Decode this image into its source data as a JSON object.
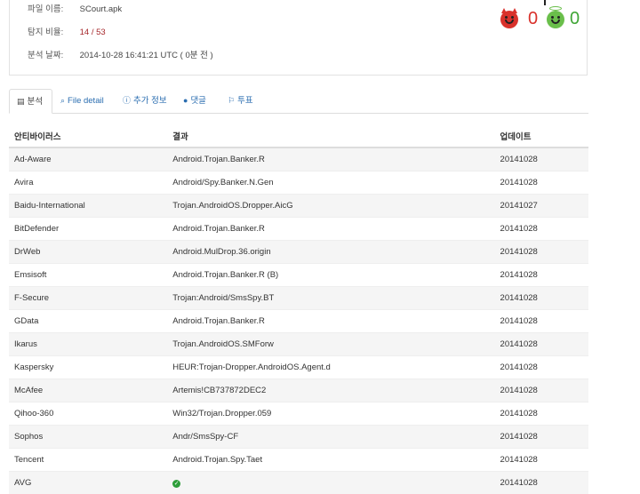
{
  "file_info": {
    "filename_label": "파일 이름:",
    "filename": "SCourt.apk",
    "detection_label": "탐지 비율:",
    "detection_ratio": "14 / 53",
    "date_label": "분석 날짜:",
    "date": "2014-10-28 16:41:21 UTC ( 0분 전 )"
  },
  "votes": {
    "malicious": "0",
    "harmless": "0"
  },
  "tabs": [
    {
      "label": "분석",
      "icon": "list-icon"
    },
    {
      "label": "File detail",
      "icon": "magnifier-icon"
    },
    {
      "label": "추가 정보",
      "icon": "info-icon"
    },
    {
      "label": "댓글",
      "icon": "comment-icon"
    },
    {
      "label": "투표",
      "icon": "thumb-icon"
    }
  ],
  "table": {
    "headers": [
      "안티바이러스",
      "결과",
      "업데이트"
    ],
    "rows": [
      {
        "av": "Ad-Aware",
        "result": "Android.Trojan.Banker.R",
        "update": "20141028"
      },
      {
        "av": "Avira",
        "result": "Android/Spy.Banker.N.Gen",
        "update": "20141028"
      },
      {
        "av": "Baidu-International",
        "result": "Trojan.AndroidOS.Dropper.AicG",
        "update": "20141027"
      },
      {
        "av": "BitDefender",
        "result": "Android.Trojan.Banker.R",
        "update": "20141028"
      },
      {
        "av": "DrWeb",
        "result": "Android.MulDrop.36.origin",
        "update": "20141028"
      },
      {
        "av": "Emsisoft",
        "result": "Android.Trojan.Banker.R (B)",
        "update": "20141028"
      },
      {
        "av": "F-Secure",
        "result": "Trojan:Android/SmsSpy.BT",
        "update": "20141028"
      },
      {
        "av": "GData",
        "result": "Android.Trojan.Banker.R",
        "update": "20141028"
      },
      {
        "av": "Ikarus",
        "result": "Trojan.AndroidOS.SMForw",
        "update": "20141028"
      },
      {
        "av": "Kaspersky",
        "result": "HEUR:Trojan-Dropper.AndroidOS.Agent.d",
        "update": "20141028"
      },
      {
        "av": "McAfee",
        "result": "Artemis!CB737872DEC2",
        "update": "20141028"
      },
      {
        "av": "Qihoo-360",
        "result": "Win32/Trojan.Dropper.059",
        "update": "20141028"
      },
      {
        "av": "Sophos",
        "result": "Andr/SmsSpy-CF",
        "update": "20141028"
      },
      {
        "av": "Tencent",
        "result": "Android.Trojan.Spy.Taet",
        "update": "20141028"
      },
      {
        "av": "AVG",
        "result": "",
        "clean": true,
        "update": "20141028"
      }
    ]
  },
  "colors": {
    "detection": "#8b1a1a",
    "malicious": "#d9312b",
    "harmless": "#3fa535",
    "link": "#2a6db0"
  }
}
